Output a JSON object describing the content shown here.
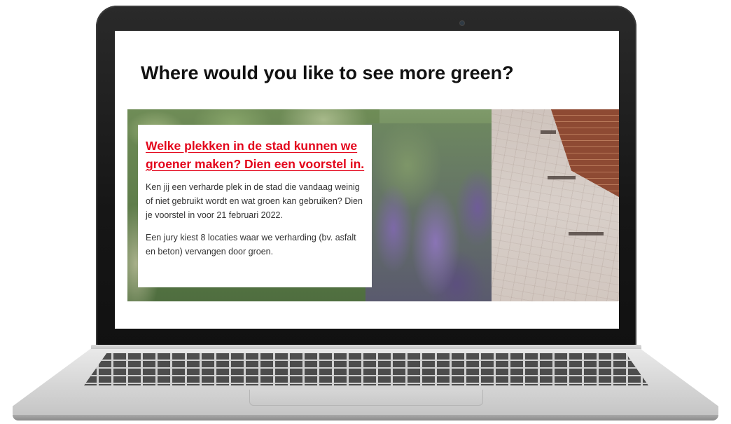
{
  "headline": "Where would you like to see more green?",
  "card": {
    "title": "Welke plekken in de stad kunnen we groener maken? Dien een voorstel in.",
    "paragraph_1": "Ken jij een verharde plek in de stad die vandaag weinig of niet gebruikt wordt en wat groen kan gebruiken? Dien je voorstel in voor 21 februari 2022.",
    "paragraph_2": "Een jury kiest 8 locaties waar we verharding (bv. asfalt en beton) vervangen door groen.",
    "title_color": "#e3051b"
  }
}
